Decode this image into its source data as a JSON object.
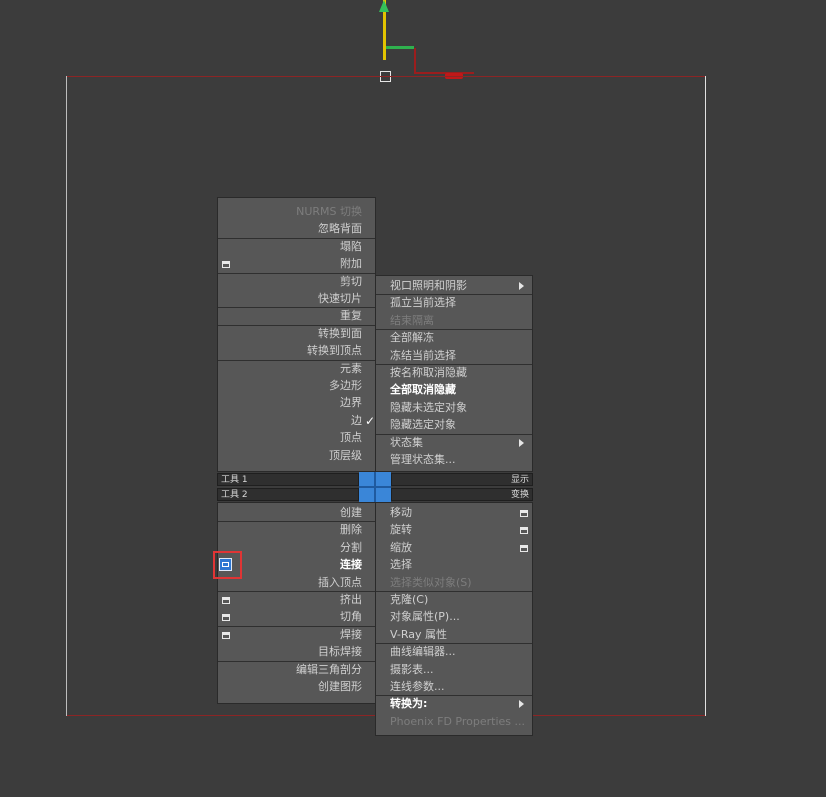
{
  "quad_titles": {
    "tools1": "工具 1",
    "tools2": "工具 2",
    "display": "显示",
    "transform": "变换"
  },
  "q_top_left": [
    {
      "label": "NURMS 切换",
      "dim": true
    },
    {
      "label": "忽略背面"
    },
    {
      "label": "塌陷"
    },
    {
      "label": "附加",
      "settings": true
    },
    {
      "label": "剪切"
    },
    {
      "label": "快速切片"
    },
    {
      "label": "重复"
    },
    {
      "label": "转换到面"
    },
    {
      "label": "转换到顶点"
    },
    {
      "label": "元素"
    },
    {
      "label": "多边形"
    },
    {
      "label": "边界"
    },
    {
      "label": "边",
      "checked": true
    },
    {
      "label": "顶点"
    },
    {
      "label": "顶层级"
    }
  ],
  "q_top_right": [
    {
      "label": "视口照明和阴影",
      "submenu": true
    },
    {
      "label": "孤立当前选择"
    },
    {
      "label": "结束隔离",
      "dim": true
    },
    {
      "label": "全部解冻"
    },
    {
      "label": "冻结当前选择"
    },
    {
      "label": "按名称取消隐藏"
    },
    {
      "label": "全部取消隐藏",
      "bold": true
    },
    {
      "label": "隐藏未选定对象"
    },
    {
      "label": "隐藏选定对象"
    },
    {
      "label": "状态集",
      "submenu": true
    },
    {
      "label": "管理状态集..."
    }
  ],
  "q_bottom_left": [
    {
      "label": "创建"
    },
    {
      "label": "删除"
    },
    {
      "label": "分割"
    },
    {
      "label": "连接",
      "bold": true,
      "settings": true,
      "highlight": true
    },
    {
      "label": "插入顶点"
    },
    {
      "label": "挤出",
      "settings": true
    },
    {
      "label": "切角",
      "settings": true
    },
    {
      "label": "焊接",
      "settings": true
    },
    {
      "label": "目标焊接"
    },
    {
      "label": "编辑三角剖分"
    },
    {
      "label": "创建图形"
    }
  ],
  "q_bottom_right": [
    {
      "label": "移动",
      "settings": true
    },
    {
      "label": "旋转",
      "settings": true
    },
    {
      "label": "缩放",
      "settings": true
    },
    {
      "label": "选择"
    },
    {
      "label": "选择类似对象(S)",
      "dim": true
    },
    {
      "label": "克隆(C)"
    },
    {
      "label": "对象属性(P)..."
    },
    {
      "label": "V-Ray 属性"
    },
    {
      "label": "曲线编辑器..."
    },
    {
      "label": "摄影表..."
    },
    {
      "label": "连线参数..."
    },
    {
      "label": "转换为:",
      "bold": true,
      "submenu": true
    },
    {
      "label": "Phoenix FD Properties ...",
      "dim": true
    }
  ],
  "colors": {
    "menu_bg": "#575757",
    "viewport_bg": "#3c3c3c",
    "quad_center": "#3a86d8",
    "highlight_outline": "#e03535"
  }
}
